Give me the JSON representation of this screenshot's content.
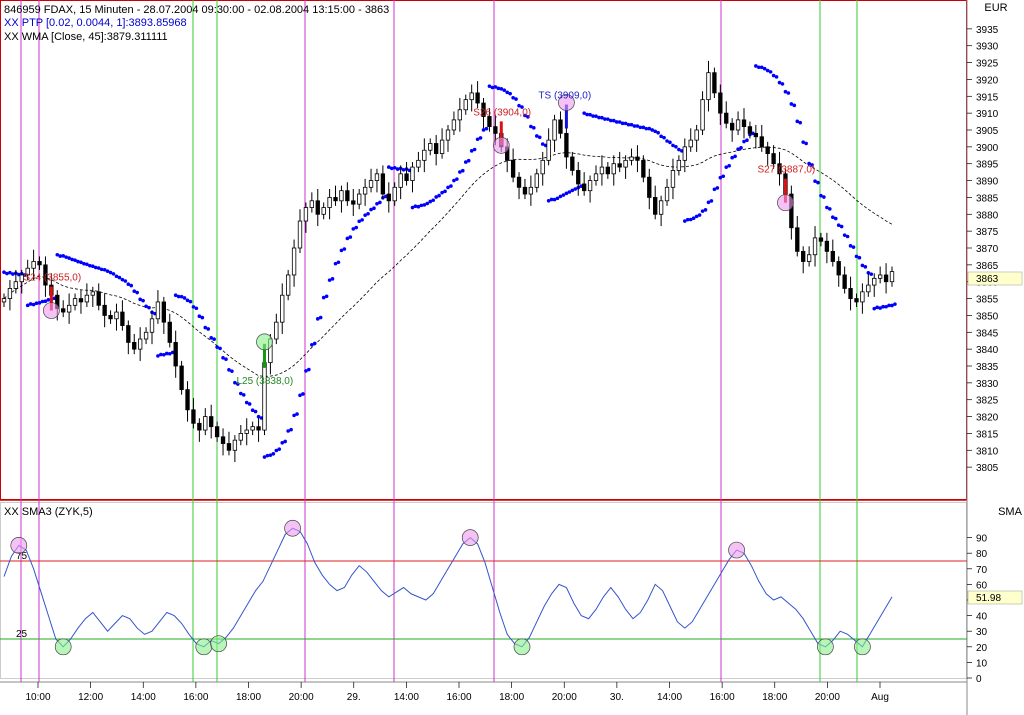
{
  "window": {
    "header_line1": "846959  FDAX, 15 Minuten - 28.07.2004 09:30:00 - 02.08.2004 13:15:00 - 3863",
    "header_line2": "XX PTP [0.02, 0.0044, 1]:3893.85968",
    "header_line3": "XX WMA [Close, 45]:3879.311111",
    "currency_label": "EUR",
    "price_readout": "3863",
    "indicator_label": "XX    SMA3 (ZYK,5)",
    "indicator_axis_label": "SMA",
    "indicator_readout": "51.98"
  },
  "colors": {
    "sell_line": "#cc33cc",
    "buy_line": "#33cc33",
    "frame": "#cc0000",
    "sar_dots": "#0000ff",
    "indicator_line": "#3355cc",
    "level_75": "#dd2222",
    "level_25": "#22aa22",
    "marker_sell": "#ee99ee",
    "marker_buy": "#88ee88"
  },
  "chart_data": {
    "type": "candlestick",
    "instrument": "FDAX",
    "interval": "15 Minuten",
    "price_axis": {
      "ylim": [
        3800,
        3940
      ],
      "ticks": [
        3805,
        3810,
        3815,
        3820,
        3825,
        3830,
        3835,
        3840,
        3845,
        3850,
        3855,
        3860,
        3865,
        3870,
        3875,
        3880,
        3885,
        3890,
        3895,
        3900,
        3905,
        3910,
        3915,
        3920,
        3925,
        3930,
        3935
      ]
    },
    "x_tick_labels": [
      "10:00",
      "12:00",
      "14:00",
      "16:00",
      "18:00",
      "20:00",
      "29.",
      "14:00",
      "16:00",
      "18:00",
      "20:00",
      "30.",
      "14:00",
      "16:00",
      "18:00",
      "20:00",
      "Aug"
    ],
    "close_series": [
      3855,
      3858,
      3860,
      3862,
      3864,
      3866,
      3865,
      3859,
      3856,
      3852,
      3851,
      3853,
      3855,
      3854,
      3856,
      3857,
      3853,
      3850,
      3849,
      3851,
      3847,
      3842,
      3840,
      3843,
      3845,
      3849,
      3854,
      3848,
      3842,
      3835,
      3828,
      3822,
      3818,
      3816,
      3820,
      3817,
      3814,
      3812,
      3810,
      3813,
      3815,
      3816,
      3817,
      3816,
      3836,
      3843,
      3848,
      3856,
      3862,
      3870,
      3878,
      3882,
      3884,
      3880,
      3882,
      3885,
      3884,
      3887,
      3884,
      3883,
      3886,
      3888,
      3890,
      3892,
      3886,
      3884,
      3888,
      3892,
      3890,
      3894,
      3896,
      3899,
      3901,
      3898,
      3902,
      3905,
      3908,
      3911,
      3914,
      3916,
      3913,
      3909,
      3906,
      3904,
      3900,
      3896,
      3891,
      3888,
      3886,
      3888,
      3892,
      3896,
      3902,
      3908,
      3904,
      3897,
      3893,
      3889,
      3887,
      3890,
      3892,
      3894,
      3892,
      3895,
      3894,
      3896,
      3897,
      3896,
      3891,
      3885,
      3880,
      3884,
      3888,
      3893,
      3896,
      3900,
      3902,
      3905,
      3914,
      3922,
      3916,
      3910,
      3907,
      3905,
      3908,
      3906,
      3904,
      3903,
      3900,
      3898,
      3895,
      3892,
      3886,
      3876,
      3869,
      3866,
      3868,
      3873,
      3872,
      3869,
      3866,
      3862,
      3858,
      3855,
      3854,
      3857,
      3859,
      3861,
      3862,
      3860,
      3863
    ],
    "wma_label": "XX WMA [Close, 45]",
    "wma_last": 3879.311111,
    "ptp_label": "XX PTP [0.02, 0.0044, 1]",
    "ptp_last": 3893.85968,
    "annotations": [
      {
        "text": "S24 (3855,0)",
        "type": "sell",
        "price": 3855,
        "bar": 8
      },
      {
        "text": "L25 (3838,0)",
        "type": "buy",
        "price": 3838,
        "bar": 44
      },
      {
        "text": "S26 (3904,0)",
        "type": "sell",
        "price": 3904,
        "bar": 84
      },
      {
        "text": "TS (3909,0)",
        "type": "ts",
        "price": 3909,
        "bar": 95
      },
      {
        "text": "S27 (3887,0)",
        "type": "sell",
        "price": 3887,
        "bar": 132
      }
    ],
    "indicator": {
      "name": "SMA3 (ZYK,5)",
      "ylim": [
        0,
        100
      ],
      "ticks": [
        0,
        10,
        20,
        30,
        40,
        50,
        60,
        70,
        80,
        90
      ],
      "levels": [
        75,
        25
      ],
      "values": [
        65,
        78,
        85,
        82,
        70,
        55,
        40,
        25,
        20,
        25,
        32,
        38,
        42,
        36,
        30,
        35,
        40,
        38,
        32,
        28,
        30,
        36,
        42,
        40,
        35,
        28,
        22,
        20,
        24,
        22,
        26,
        32,
        40,
        48,
        56,
        62,
        72,
        82,
        92,
        96,
        94,
        86,
        74,
        66,
        60,
        56,
        58,
        66,
        72,
        68,
        62,
        56,
        52,
        55,
        58,
        54,
        52,
        50,
        54,
        62,
        70,
        78,
        86,
        90,
        86,
        74,
        58,
        42,
        28,
        22,
        20,
        26,
        36,
        46,
        54,
        60,
        58,
        48,
        40,
        38,
        44,
        52,
        58,
        52,
        44,
        38,
        42,
        50,
        60,
        56,
        46,
        36,
        32,
        36,
        44,
        52,
        60,
        68,
        76,
        82,
        80,
        72,
        62,
        54,
        50,
        52,
        48,
        44,
        38,
        30,
        22,
        20,
        24,
        30,
        28,
        24,
        20,
        28,
        36,
        44,
        51.98
      ],
      "last": 51.98
    }
  }
}
